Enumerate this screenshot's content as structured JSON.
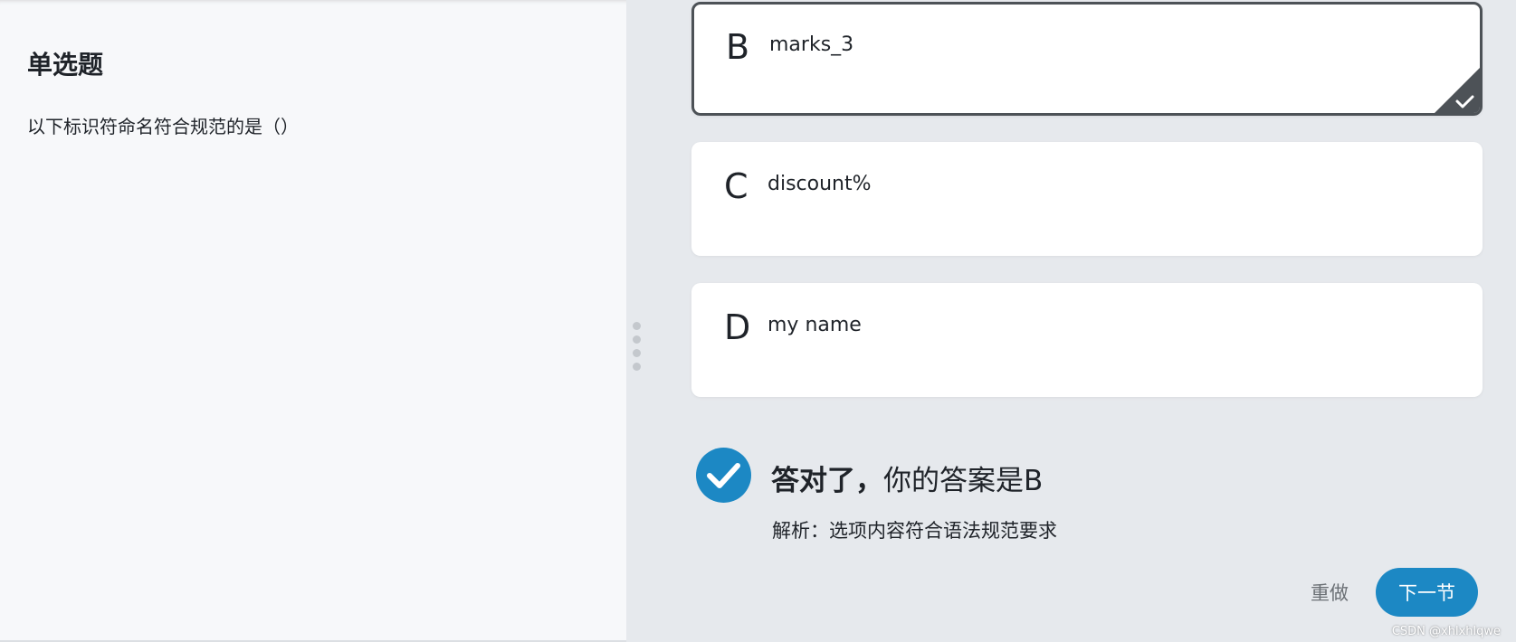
{
  "question": {
    "type_label": "单选题",
    "text": "以下标识符命名符合规范的是（）"
  },
  "options": [
    {
      "letter": "B",
      "text": "marks_3",
      "selected": true
    },
    {
      "letter": "C",
      "text": "discount%",
      "selected": false
    },
    {
      "letter": "D",
      "text": "my name",
      "selected": false
    }
  ],
  "result": {
    "title_strong": "答对了，",
    "title_rest": "你的答案是B",
    "explanation": "解析：选项内容符合语法规范要求",
    "icon": "check-circle-icon"
  },
  "actions": {
    "redo_label": "重做",
    "next_label": "下一节"
  },
  "watermark": "CSDN @xhlxhlqwe",
  "colors": {
    "accent": "#1c88c4",
    "selected_border": "#4d5257",
    "left_bg": "#f7f8fa",
    "right_bg": "#e6e9ed"
  }
}
